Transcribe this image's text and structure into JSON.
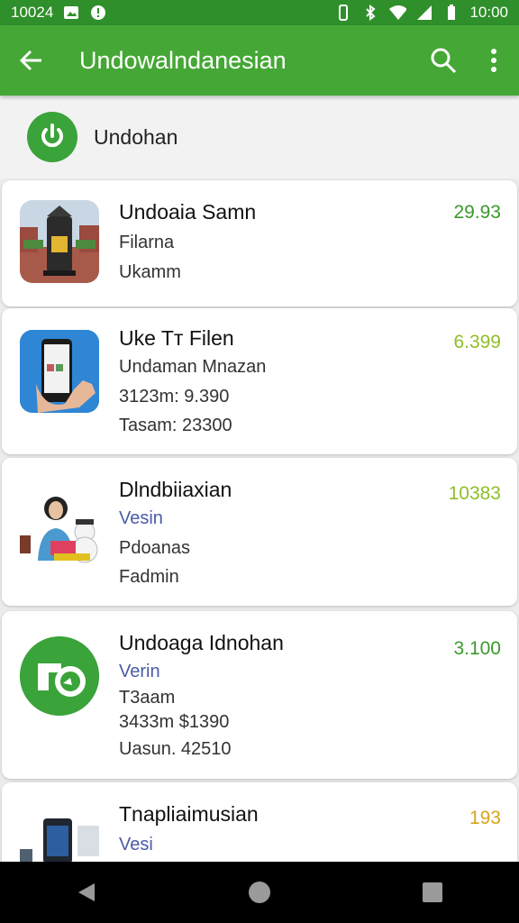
{
  "status_bar": {
    "left_text": "10024",
    "right_text": "10:00"
  },
  "toolbar": {
    "title": "Undowalndanesian"
  },
  "section": {
    "title": "Undohan"
  },
  "items": [
    {
      "title": "Undoaia Samn",
      "lines": [
        "Filarna",
        "Ukamm"
      ],
      "price": "29.93",
      "price_color": "#3a9a2a"
    },
    {
      "title": "Uke Tт Filen",
      "lines": [
        "Undaman Mnazan",
        "3123m: 9.390",
        "Tasam: 23300"
      ],
      "price": "6.399",
      "price_color": "#8fbf28"
    },
    {
      "title": "Dlndbiiaxian",
      "lines": [
        "Vesin",
        "Pdoanas",
        "Fadmin"
      ],
      "price": "10383",
      "price_color": "#8fbf28"
    },
    {
      "title": "Undoaga Idnohan",
      "lines": [
        "Verin",
        "T3aam",
        "3433m $1390",
        "Uasun. 42510"
      ],
      "price": "3.100",
      "price_color": "#3a9a2a"
    },
    {
      "title": "Tnapliaimusian",
      "lines": [
        "Vesi"
      ],
      "price": "193",
      "price_color": "#d6a41c"
    }
  ],
  "colors": {
    "status_bar": "#2f8f2a",
    "toolbar": "#45a735",
    "accent": "#3aa33a"
  }
}
